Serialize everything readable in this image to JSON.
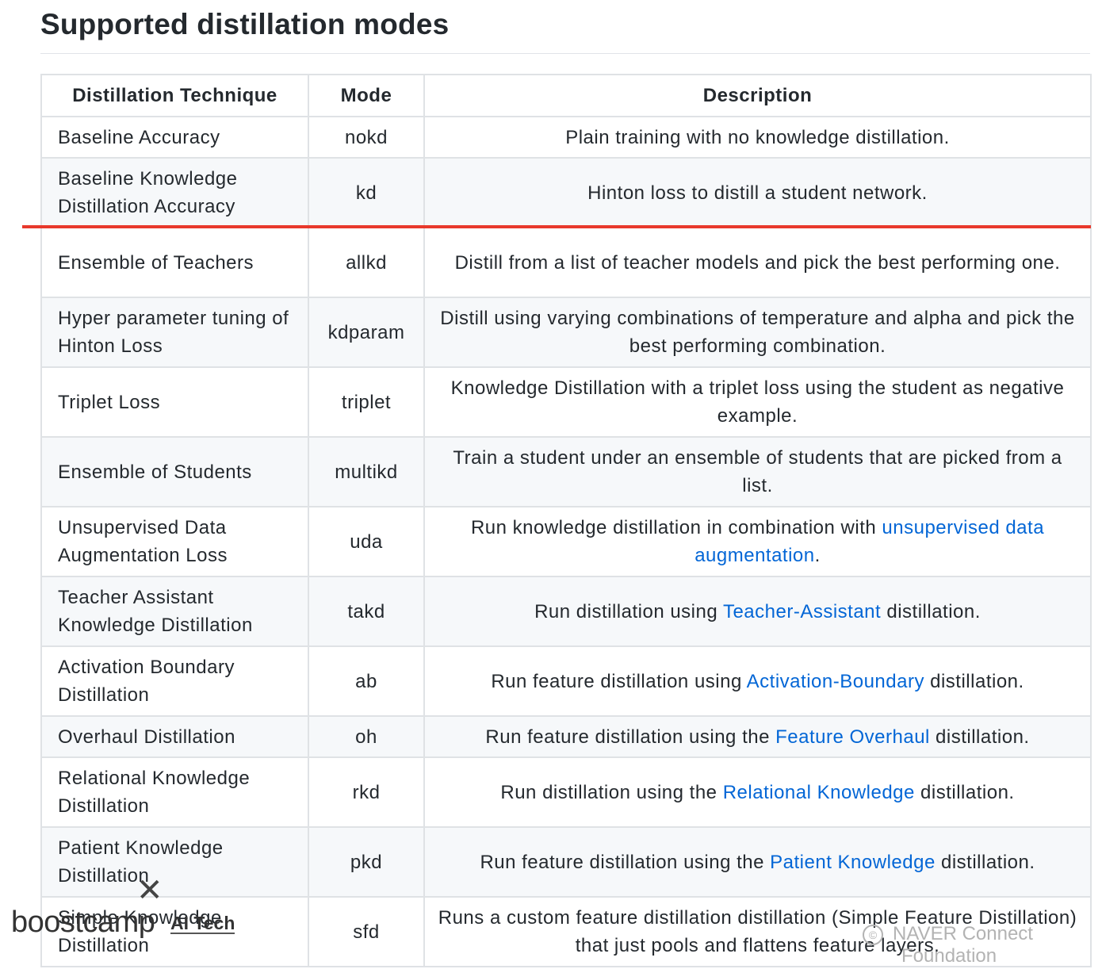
{
  "page": {
    "title": "Supported distillation modes"
  },
  "table": {
    "headers": [
      "Distillation Technique",
      "Mode",
      "Description"
    ],
    "rows": [
      {
        "technique": "Baseline Accuracy",
        "mode": "nokd",
        "desc_pre": "Plain training with no knowledge distillation.",
        "desc_link": "",
        "desc_post": ""
      },
      {
        "technique": "Baseline Knowledge Distillation Accuracy",
        "mode": "kd",
        "desc_pre": "Hinton loss to distill a student network.",
        "desc_link": "",
        "desc_post": ""
      },
      {
        "technique": "Ensemble of Teachers",
        "mode": "allkd",
        "desc_pre": "Distill from a list of teacher models and pick the best performing one.",
        "desc_link": "",
        "desc_post": ""
      },
      {
        "technique": "Hyper parameter tuning of Hinton Loss",
        "mode": "kdparam",
        "desc_pre": "Distill using varying combinations of temperature and alpha and pick the best performing combination.",
        "desc_link": "",
        "desc_post": ""
      },
      {
        "technique": "Triplet Loss",
        "mode": "triplet",
        "desc_pre": "Knowledge Distillation with a triplet loss using the student as negative example.",
        "desc_link": "",
        "desc_post": ""
      },
      {
        "technique": "Ensemble of Students",
        "mode": "multikd",
        "desc_pre": "Train a student under an ensemble of students that are picked from a list.",
        "desc_link": "",
        "desc_post": ""
      },
      {
        "technique": "Unsupervised Data Augmentation Loss",
        "mode": "uda",
        "desc_pre": "Run knowledge distillation in combination with ",
        "desc_link": "unsupervised data augmentation",
        "desc_post": "."
      },
      {
        "technique": "Teacher Assistant Knowledge Distillation",
        "mode": "takd",
        "desc_pre": "Run distillation using ",
        "desc_link": "Teacher-Assistant",
        "desc_post": " distillation."
      },
      {
        "technique": "Activation Boundary Distillation",
        "mode": "ab",
        "desc_pre": "Run feature distillation using ",
        "desc_link": "Activation-Boundary",
        "desc_post": " distillation."
      },
      {
        "technique": "Overhaul Distillation",
        "mode": "oh",
        "desc_pre": "Run feature distillation using the ",
        "desc_link": "Feature Overhaul",
        "desc_post": " distillation."
      },
      {
        "technique": "Relational Knowledge Distillation",
        "mode": "rkd",
        "desc_pre": "Run distillation using the ",
        "desc_link": "Relational Knowledge",
        "desc_post": " distillation."
      },
      {
        "technique": "Patient Knowledge Distillation",
        "mode": "pkd",
        "desc_pre": "Run feature distillation using the ",
        "desc_link": "Patient Knowledge",
        "desc_post": " distillation."
      },
      {
        "technique": "Simple Knowledge Distillation",
        "mode": "sfd",
        "desc_pre": "Runs a custom feature distillation distillation (Simple Feature Distillation) that just pools and flattens feature layers.",
        "desc_link": "",
        "desc_post": ""
      }
    ]
  },
  "watermarks": {
    "brand": "boostcamp",
    "cross": "✕",
    "aitech": "AI Tech",
    "copyright_symbol": "©",
    "naver_line1": "NAVER Connect",
    "naver_line2": "Foundation"
  },
  "colors": {
    "link": "#0366d6",
    "highlight_line": "#e8392c",
    "border": "#dfe2e5",
    "stripe": "#f6f8fa"
  }
}
